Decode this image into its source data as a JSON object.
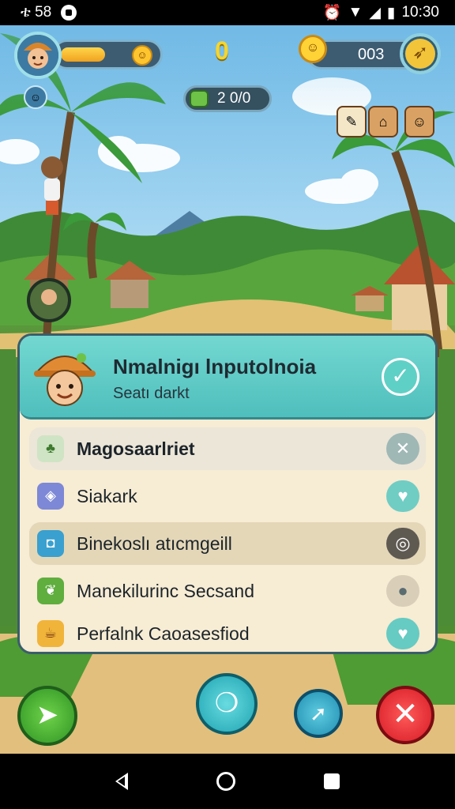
{
  "status_bar": {
    "left_text": "ቴ 58",
    "time": "10:30"
  },
  "hud": {
    "xp_progress": 0.6,
    "score": "0",
    "coins": "003",
    "gems": "2 0/0"
  },
  "panel": {
    "title": "Nmalnigı lnputolnoia",
    "subtitle": "Seatı darkt",
    "rows": [
      {
        "label": "Magosaarlriet",
        "icon": "plant-icon",
        "action": "close-icon"
      },
      {
        "label": "Siakark",
        "icon": "map-icon",
        "action": "heart-icon"
      },
      {
        "label": "Binekoslı atıcmgeill",
        "icon": "chat-icon",
        "action": "target-icon"
      },
      {
        "label": "Manekilurinc Secsand",
        "icon": "leaf-icon",
        "action": "pin-icon"
      },
      {
        "label": "Perfalnk Caoasesfiod",
        "icon": "cup-icon",
        "action": "heart-icon"
      }
    ]
  },
  "colors": {
    "accent_teal": "#4fbfbd",
    "panel_bg": "#f7ecd4",
    "close_red": "#e5232c",
    "confirm_green": "#45b93a"
  }
}
